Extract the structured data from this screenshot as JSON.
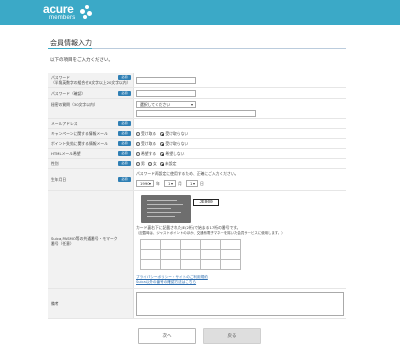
{
  "header": {
    "brand": "acure",
    "brand_sub": "members"
  },
  "page": {
    "title": "会員情報入力",
    "intro": "以下の項目をご入力ください。",
    "required_badge": "必須"
  },
  "fields": {
    "password": {
      "label": "パスワード\n（半角英数字の組合せ8文字以上20文字以内）"
    },
    "password_confirm": {
      "label": "パスワード（確認）"
    },
    "security_question": {
      "label": "秘密の質問（30文字以内）",
      "select_value": "選択してください"
    },
    "email": {
      "label": "メールアドレス"
    },
    "campaign_mail": {
      "label": "キャンペーンに関する情報メール",
      "opt_yes": "受け取る",
      "opt_no": "受け取らない"
    },
    "point_mail": {
      "label": "ポイント失効に関する情報メール",
      "opt_yes": "受け取る",
      "opt_no": "受け取らない"
    },
    "html_mail": {
      "label": "HTMLメール希望",
      "opt_yes": "希望する",
      "opt_no": "希望しない"
    },
    "gender": {
      "label": "性別",
      "opt_male": "男",
      "opt_female": "女",
      "opt_none": "未設定"
    },
    "birthday": {
      "label": "生年月日",
      "note": "パスワード再設定に使用するため、正確にご入力ください。",
      "year": "1990",
      "year_unit": "年",
      "month": "1",
      "month_unit": "月",
      "day": "1",
      "day_unit": "日"
    },
    "suica": {
      "label": "Suica,PASMO等の共通番号・モマーク\n番号（任意）",
      "card_code": "JE000",
      "desc1": "カード裏右下に記載されたJE(2桁)で始まる17桁の番号です。",
      "desc2": "（記載時は、ジャストポイントのほか、交通系電子マネーを除いた会員サービスに使用します。）",
      "link1": "プライバシーポリシー・サイトのご利用規約",
      "link2": "Suica以外の番号の確認方法はこちら"
    },
    "remarks": {
      "label": "備考"
    }
  },
  "buttons": {
    "next": "次へ",
    "back": "戻る"
  },
  "colors": {
    "header": "#3ba9c7",
    "badge": "#2f7fb4"
  }
}
